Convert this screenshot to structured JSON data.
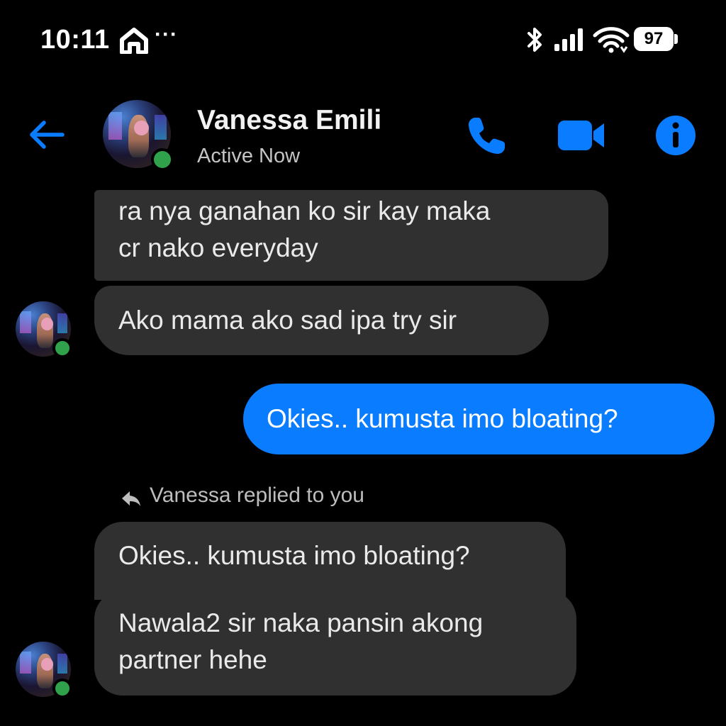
{
  "status_bar": {
    "time": "10:11",
    "battery": "97",
    "icons": [
      "home-icon",
      "more-dots",
      "bluetooth-icon",
      "signal-icon",
      "wifi-icon",
      "battery-icon"
    ]
  },
  "header": {
    "contact_name": "Vanessa Emili",
    "status": "Active Now",
    "icons": [
      "back-arrow-icon",
      "phone-icon",
      "video-camera-icon",
      "info-icon"
    ]
  },
  "colors": {
    "accent": "#0a7cff",
    "incoming_bubble": "#303030",
    "online": "#31a24c",
    "background": "#000000"
  },
  "messages": [
    {
      "direction": "in",
      "lines": [
        "ra nya ganahan ko sir kay maka",
        "cr nako everyday"
      ]
    },
    {
      "direction": "in",
      "lines": [
        "Ako mama ako sad ipa try sir"
      ]
    },
    {
      "direction": "out",
      "lines": [
        "Okies.. kumusta imo bloating?"
      ]
    },
    {
      "direction": "in",
      "reply_note": "Vanessa replied to you",
      "quoted": "Okies.. kumusta imo bloating?",
      "lines": [
        "Nawala2 sir naka pansin akong",
        "partner hehe"
      ]
    }
  ]
}
